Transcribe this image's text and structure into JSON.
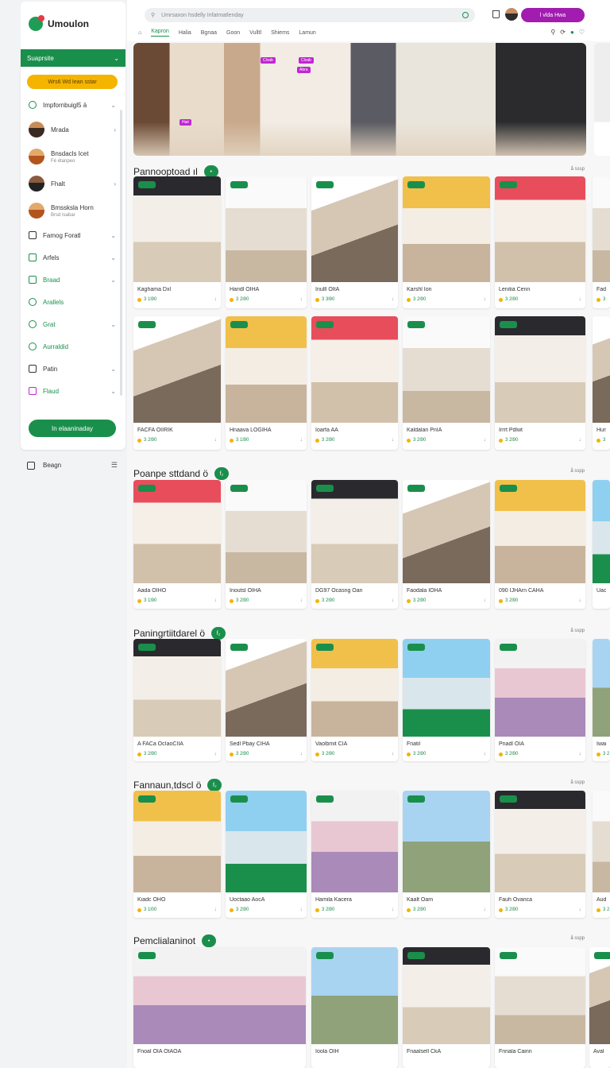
{
  "app": {
    "name": "Umoulon"
  },
  "sidebar": {
    "header": "Suaprsite",
    "cta": "Wrs6 Wd Iean sstar",
    "items": [
      {
        "label": "Impfornbuigl5 ä",
        "type": "icon"
      },
      {
        "label": "Mrada",
        "type": "avatar"
      },
      {
        "label": "Bnsdacls Icet",
        "sub": "Fé étanpeo",
        "type": "avatar"
      },
      {
        "label": "Fhalt",
        "type": "avatar"
      },
      {
        "label": "Bmssksla Horn",
        "sub": "Brsd Isabar",
        "type": "avatar"
      },
      {
        "label": "Famog Foratl",
        "type": "icon"
      },
      {
        "label": "Arfels",
        "type": "icon"
      },
      {
        "label": "Braad",
        "type": "icon"
      },
      {
        "label": "Arallels",
        "type": "icon"
      },
      {
        "label": "Grat",
        "type": "icon"
      },
      {
        "label": "Aurraldid",
        "type": "icon"
      },
      {
        "label": "Patin",
        "type": "icon"
      },
      {
        "label": "Flaud",
        "type": "icon"
      }
    ],
    "bottom_button": "In elaaninaday",
    "footer": "Beagn"
  },
  "topbar": {
    "search_placeholder": "Umrsaxon hsdelly Infatmatlenday",
    "button": "l vlda Hwa",
    "tabs": [
      "Kapron",
      "Halia",
      "Bgnaa",
      "Goon",
      "Vulltl",
      "Shiems",
      "Lamun"
    ],
    "active_tab": 0
  },
  "hero": {
    "tags": [
      "Clvab",
      "Clvab",
      "Abra",
      "Hair"
    ]
  },
  "sections": [
    {
      "title": "Pannooptoad ıl",
      "count": "•",
      "more": "å sssp",
      "cards": [
        {
          "caption": "Kaghama Dxl",
          "price": "3 1l90"
        },
        {
          "caption": "Haridl OIHA",
          "price": "3 2l90"
        },
        {
          "caption": "Inulll OItA",
          "price": "3 3l90"
        },
        {
          "caption": "Karshl Ion",
          "price": "3 2l90"
        },
        {
          "caption": "Lenitia Cenn",
          "price": "3 2l90"
        },
        {
          "caption": "Fadr",
          "price": "3"
        }
      ]
    },
    {
      "title": "",
      "count": "",
      "more": "",
      "cards": [
        {
          "caption": "FACFA OIIRIK",
          "price": "3 2l90"
        },
        {
          "caption": "Hnaava LOGIHA",
          "price": "3 1l90"
        },
        {
          "caption": "Ioarfa AA",
          "price": "3 2l90"
        },
        {
          "caption": "Kaldalan PnIA",
          "price": "3 2l90"
        },
        {
          "caption": "Irrrt Pdlwt",
          "price": "3 2l90"
        },
        {
          "caption": "Hurr",
          "price": "3"
        }
      ]
    },
    {
      "title": "Poanpe sttdand ö",
      "count": "f₂",
      "more": "å sspp",
      "cards": [
        {
          "caption": "Aada OIHO",
          "price": "3 1l90"
        },
        {
          "caption": "Inoutsl OIHA",
          "price": "3 2l90"
        },
        {
          "caption": "DG97 Ocasng Oan",
          "price": "3 2l90"
        },
        {
          "caption": "Faodala IOHA",
          "price": "3 2l90"
        },
        {
          "caption": "090 IJHArn CAHA",
          "price": "3 2l90"
        },
        {
          "caption": "Uaou",
          "price": ""
        }
      ]
    },
    {
      "title": "Paningrtiitdarel ö",
      "count": "f₂",
      "more": "å sspp",
      "cards": [
        {
          "caption": "A FACa OcIaoCIIA",
          "price": "3 2l90"
        },
        {
          "caption": "Sedl Pbay CIHA",
          "price": "3 2l90"
        },
        {
          "caption": "Vaolbmit CIA",
          "price": "3 2l90"
        },
        {
          "caption": "Fnatil",
          "price": "3 2l90"
        },
        {
          "caption": "Pnadl OIA",
          "price": "3 2l90"
        },
        {
          "caption": "Iwar",
          "price": "3 2"
        }
      ]
    },
    {
      "title": "Fannaun,tdscl ö",
      "count": "f₂",
      "more": "å sspp",
      "cards": [
        {
          "caption": "Kiadc OHO",
          "price": "3 1l00"
        },
        {
          "caption": "Uoctaao AocA",
          "price": "3 2l90"
        },
        {
          "caption": "Hamila Kacera",
          "price": "3 2l90"
        },
        {
          "caption": "Kaalt Oam",
          "price": "3 2l90"
        },
        {
          "caption": "Fauh Ovanca",
          "price": "3 2l90"
        },
        {
          "caption": "Auda",
          "price": "3 2"
        }
      ]
    },
    {
      "title": "Pemclialaninot",
      "count": "•",
      "more": "å sspp",
      "cards": [
        {
          "caption": "Fnoal OIA OtAOA",
          "price": ""
        },
        {
          "caption": "Ioola OIH",
          "price": ""
        },
        {
          "caption": "Fnaalsell CkA",
          "price": ""
        },
        {
          "caption": "Fnnala Cainn",
          "price": ""
        },
        {
          "caption": "Aval",
          "price": ""
        }
      ]
    }
  ]
}
